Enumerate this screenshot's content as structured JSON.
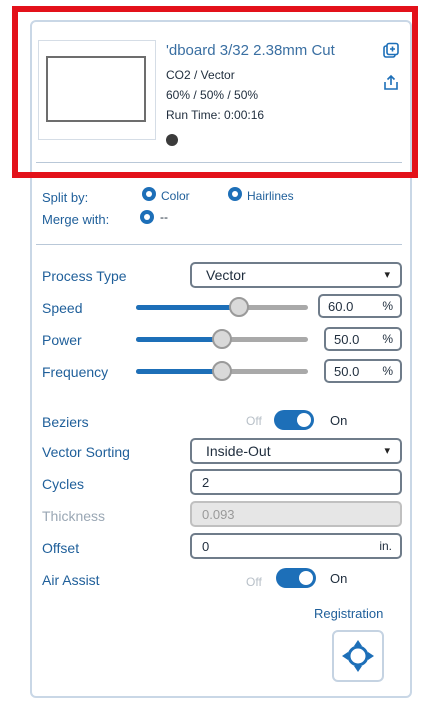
{
  "layer": {
    "name": "'dboard 3/32 2.38mm Cut",
    "line1": "CO2 / Vector",
    "line2": "60% / 50% / 50%",
    "line3": "Run Time: 0:00:16"
  },
  "split": {
    "label": "Split by:",
    "options": [
      "Color",
      "Hairlines"
    ]
  },
  "merge": {
    "label": "Merge with:",
    "value": "--"
  },
  "process_type": {
    "label": "Process Type",
    "value": "Vector"
  },
  "speed": {
    "label": "Speed",
    "value": "60.0",
    "unit": "%",
    "level": 0.6
  },
  "power": {
    "label": "Power",
    "value": "50.0",
    "unit": "%",
    "level": 0.5
  },
  "frequency": {
    "label": "Frequency",
    "value": "50.0",
    "unit": "%",
    "level": 0.5
  },
  "beziers": {
    "label": "Beziers",
    "off": "Off",
    "on": "On"
  },
  "vector_sorting": {
    "label": "Vector Sorting",
    "value": "Inside-Out"
  },
  "cycles": {
    "label": "Cycles",
    "value": "2"
  },
  "thickness": {
    "label": "Thickness",
    "placeholder": "0.093"
  },
  "offset": {
    "label": "Offset",
    "value": "0",
    "unit": "in."
  },
  "air_assist": {
    "label": "Air Assist",
    "off": "Off",
    "on": "On"
  },
  "registration": {
    "label": "Registration"
  },
  "icons": [
    "copy-layer-icon",
    "export-icon",
    "chevron-down-icon",
    "registration-crosshair-icon"
  ],
  "colors": {
    "accent": "#1d6fb8",
    "label": "#1f5f9a",
    "highlight": "#e3111a"
  }
}
